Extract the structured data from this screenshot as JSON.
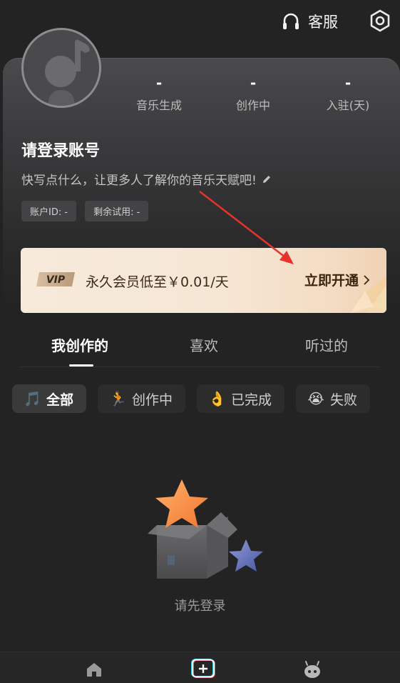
{
  "header": {
    "customer_service_label": "客服",
    "icons": [
      "headphones-icon",
      "settings-icon"
    ]
  },
  "profile": {
    "stats": [
      {
        "value": "-",
        "label": "音乐生成"
      },
      {
        "value": "-",
        "label": "创作中"
      },
      {
        "value": "-",
        "label": "入驻(天)"
      }
    ],
    "username": "请登录账号",
    "bio": "快写点什么，让更多人了解你的音乐天赋吧!",
    "chips": [
      "账户ID: -",
      "剩余试用: -"
    ]
  },
  "vip": {
    "badge": "VIP",
    "text": "永久会员低至￥0.01/天",
    "cta": "立即开通"
  },
  "tabs": [
    {
      "label": "我创作的",
      "active": true
    },
    {
      "label": "喜欢",
      "active": false
    },
    {
      "label": "听过的",
      "active": false
    }
  ],
  "filters": [
    {
      "icon": "🎵",
      "label": "全部",
      "active": true
    },
    {
      "icon": "🏃",
      "label": "创作中",
      "active": false
    },
    {
      "icon": "👌",
      "label": "已完成",
      "active": false
    },
    {
      "icon": "😭",
      "label": "失败",
      "active": false
    }
  ],
  "empty_state": {
    "text": "请先登录"
  },
  "colors": {
    "background": "#232323",
    "vip_gradient_start": "#f7eadb",
    "vip_gradient_end": "#f0d2b4",
    "annotation_red": "#e8322b"
  }
}
